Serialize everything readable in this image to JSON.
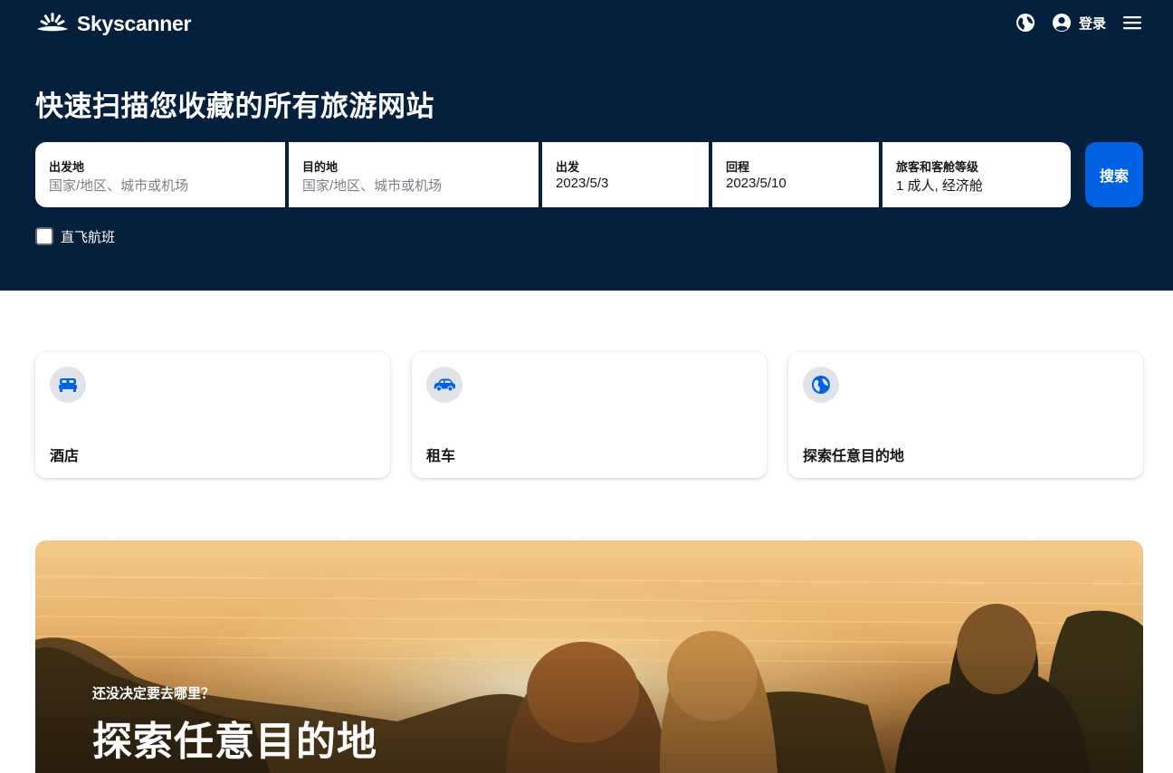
{
  "header": {
    "brand": "Skyscanner",
    "login_label": "登录"
  },
  "hero": {
    "title": "快速扫描您收藏的所有旅游网站"
  },
  "search": {
    "origin": {
      "label": "出发地",
      "placeholder": "国家/地区、城市或机场"
    },
    "destination": {
      "label": "目的地",
      "placeholder": "国家/地区、城市或机场"
    },
    "depart": {
      "label": "出发",
      "value": "2023/5/3"
    },
    "return": {
      "label": "回程",
      "value": "2023/5/10"
    },
    "travellers": {
      "label": "旅客和客舱等级",
      "value": "1 成人, 经济舱"
    },
    "button_label": "搜索",
    "direct_flights_label": "直飞航班",
    "direct_flights_checked": false
  },
  "cards": [
    {
      "label": "酒店",
      "icon": "bed-icon"
    },
    {
      "label": "租车",
      "icon": "car-icon"
    },
    {
      "label": "探索任意目的地",
      "icon": "globe-icon"
    }
  ],
  "promo": {
    "kicker": "还没决定要去哪里？",
    "title": "探索任意目的地"
  },
  "colors": {
    "header_bg": "#05203c",
    "accent_blue": "#0062e3",
    "card_icon_bg": "#e0e4e9"
  }
}
